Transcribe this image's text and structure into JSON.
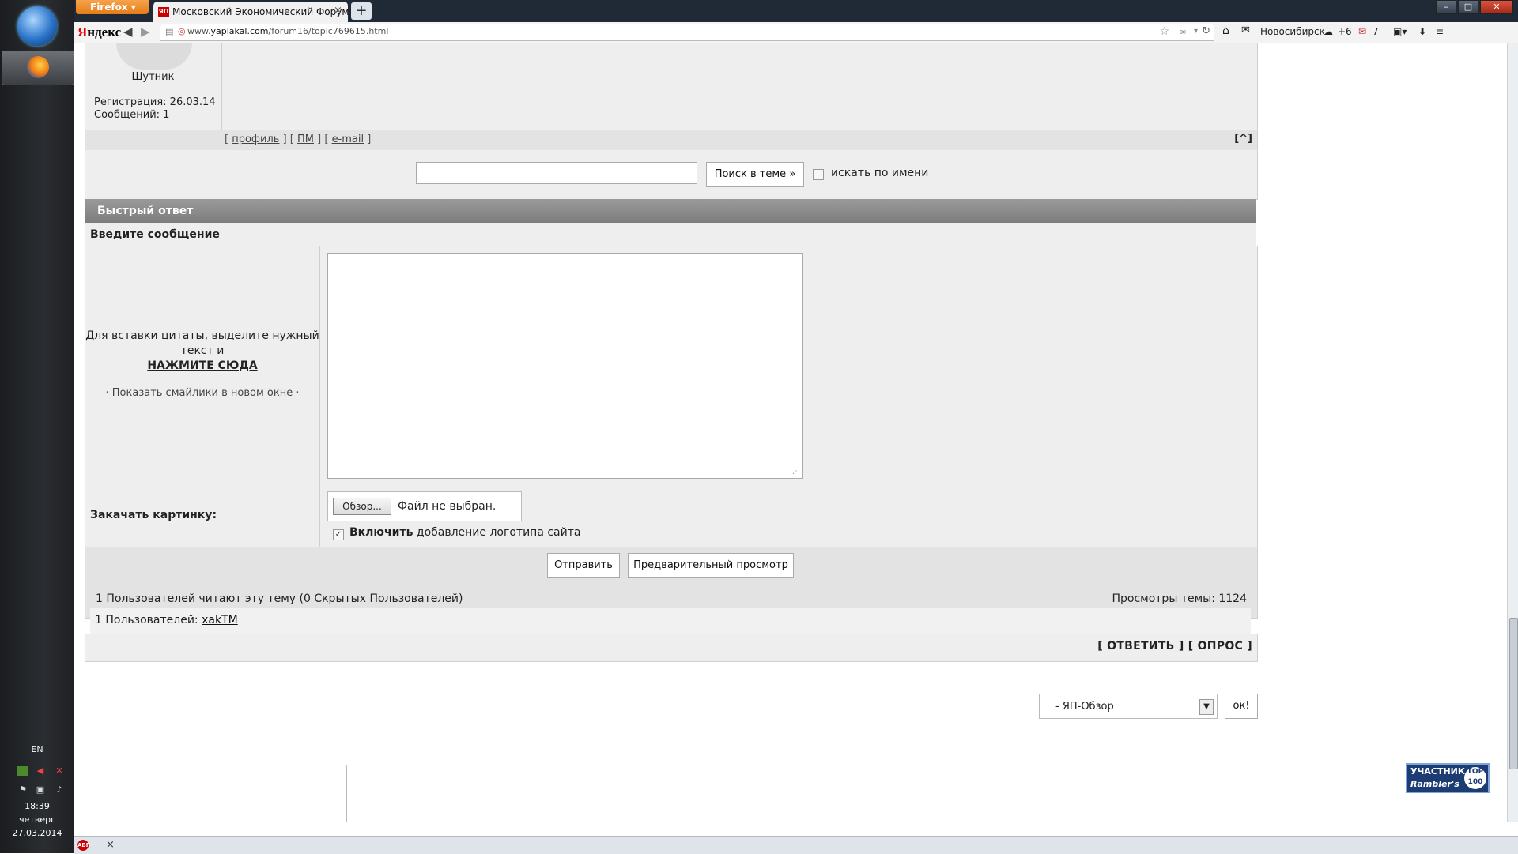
{
  "taskbar": {
    "lang": "EN",
    "time": "18:39",
    "weekday": "четверг",
    "date": "27.03.2014"
  },
  "browser": {
    "menu_label": "Firefox",
    "tab_title": "Московский Экономический Форум. ...",
    "tab_favicon": "ЯП",
    "address_prefix": "www.",
    "address_domain": "yaplakal.com",
    "address_path": "/forum16/topic769615.html",
    "toolbar_logo_y": "Я",
    "toolbar_logo_rest": "ндекс",
    "city": "Новосибирск",
    "weather": "+6",
    "mail_count": "7"
  },
  "profile": {
    "username": "Шутник",
    "registration": "Регистрация: 26.03.14",
    "posts": "Сообщений: 1",
    "links": [
      "профиль",
      "ПМ",
      "e-mail"
    ],
    "top_link": "[^]"
  },
  "search": {
    "button": "Поиск в теме »",
    "by_name_label": "искать по имени"
  },
  "quick_reply": {
    "header": "Быстрый ответ",
    "enter_message": "Введите сообщение",
    "quote_help": "Для вставки цитаты, выделите нужный текст и",
    "quote_click": "НАЖМИТЕ СЮДА",
    "smilies_link": "Показать смайлики в новом окне",
    "upload_label": "Закачать картинку:",
    "browse_button": "Обзор...",
    "file_status": "Файл не выбран.",
    "logo_bold": "Включить",
    "logo_rest": " добавление логотипа сайта",
    "send_button": "Отправить",
    "preview_button": "Предварительный просмотр"
  },
  "stats": {
    "readers": "1 Пользователей читают эту тему (0 Скрытых Пользователей)",
    "views": "Просмотры темы: 1124",
    "users_prefix": "1 Пользователей: ",
    "user_link": "xakTM",
    "actions": "[ ОТВЕТИТЬ ] [ ОПРОС ]"
  },
  "jump": {
    "selected": "-  ЯП-Обзор",
    "ok_button": "ок!"
  },
  "rambler": {
    "line1": "УЧАСТНИК",
    "line2": "Rambler's",
    "top": "TOP 100"
  }
}
